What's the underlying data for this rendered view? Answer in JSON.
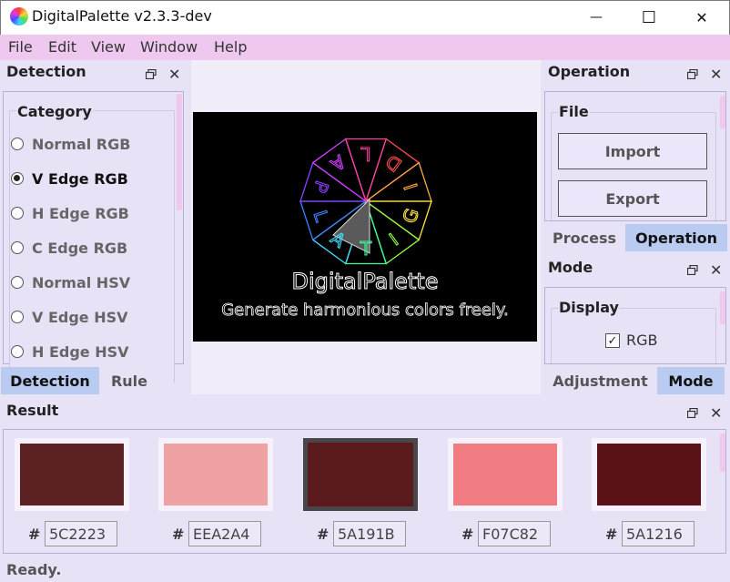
{
  "window": {
    "title": "DigitalPalette v2.3.3-dev",
    "minimize_glyph": "—",
    "maximize_glyph": "☐",
    "close_glyph": "✕"
  },
  "menu": [
    "File",
    "Edit",
    "View",
    "Window",
    "Help"
  ],
  "detection_panel": {
    "title": "Detection",
    "group_label": "Category",
    "options": [
      {
        "label": "Normal RGB",
        "selected": false
      },
      {
        "label": "V Edge RGB",
        "selected": true
      },
      {
        "label": "H Edge RGB",
        "selected": false
      },
      {
        "label": "C Edge RGB",
        "selected": false
      },
      {
        "label": "Normal HSV",
        "selected": false
      },
      {
        "label": "V Edge HSV",
        "selected": false
      },
      {
        "label": "H Edge HSV",
        "selected": false
      }
    ],
    "tabs": [
      {
        "label": "Detection",
        "active": true
      },
      {
        "label": "Rule",
        "active": false
      }
    ]
  },
  "canvas": {
    "logo_letters": [
      "D",
      "I",
      "G",
      "I",
      "T",
      "A",
      "L",
      "P",
      "A",
      "L"
    ],
    "headline": "DigitalPalette",
    "tagline": "Generate harmonious colors freely."
  },
  "operation_panel": {
    "title": "Operation",
    "group_label": "File",
    "import_label": "Import",
    "export_label": "Export",
    "tabs": [
      {
        "label": "Process",
        "active": false
      },
      {
        "label": "Operation",
        "active": true
      }
    ]
  },
  "mode_panel": {
    "title": "Mode",
    "group_label": "Display",
    "checkbox_label": "RGB",
    "checkbox_checked": true,
    "tabs": [
      {
        "label": "Adjustment",
        "active": false
      },
      {
        "label": "Mode",
        "active": true
      }
    ]
  },
  "result_panel": {
    "title": "Result",
    "hash": "#",
    "swatches": [
      {
        "color": "#5c2223",
        "hex": "5C2223",
        "selected": false
      },
      {
        "color": "#eea2a4",
        "hex": "EEA2A4",
        "selected": false
      },
      {
        "color": "#5a191b",
        "hex": "5A191B",
        "selected": true
      },
      {
        "color": "#f07c82",
        "hex": "F07C82",
        "selected": false
      },
      {
        "color": "#5a1216",
        "hex": "5A1216",
        "selected": false
      }
    ]
  },
  "status": "Ready.",
  "colors": {
    "menubar": "#eec8ef",
    "panel": "#e8e2f7",
    "active_tab": "#b9cbf1",
    "canvas_bg": "#000000"
  }
}
